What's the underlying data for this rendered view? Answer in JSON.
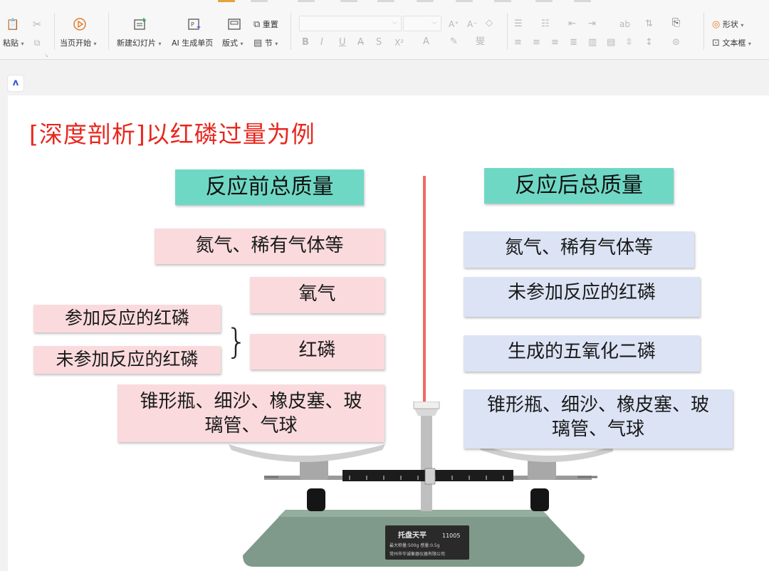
{
  "toolbar": {
    "paste_label": "粘贴",
    "start_from_current_label": "当页开始",
    "new_slide_label": "新建幻灯片",
    "ai_generate_label": "AI 生成单页",
    "layout_label": "版式",
    "reset_label": "重置",
    "section_label": "节",
    "shape_label": "形状",
    "textbox_label": "文本框"
  },
  "slide": {
    "title": "[深度剖析]以红磷过量为例",
    "left_header": "反应前总质量",
    "right_header": "反应后总质量",
    "left_items": {
      "nitrogen": "氮气、稀有气体等",
      "oxygen": "氧气",
      "phosphorus": "红磷",
      "reacted_phosphorus": "参加反应的红磷",
      "unreacted_phosphorus": "未参加反应的红磷",
      "apparatus_line1": "锥形瓶、细沙、橡皮塞、玻",
      "apparatus_line2": "璃管、气球"
    },
    "right_items": {
      "nitrogen": "氮气、稀有气体等",
      "unreacted_phosphorus": "未参加反应的红磷",
      "product": "生成的五氧化二磷",
      "apparatus_line1": "锥形瓶、细沙、橡皮塞、玻",
      "apparatus_line2": "璃管、气球"
    },
    "balance": {
      "plate_text": "托盘天平",
      "model": "11005",
      "spec": "最大称量:500g  感量:0.5g",
      "maker": "常州市华诚衡器仪器有限公司"
    }
  },
  "colors": {
    "title": "#e8271e",
    "header_bg": "#6fd8c5",
    "left_box_bg": "#fadadd",
    "right_box_bg": "#dbe3f4",
    "divider": "#f06a6a"
  }
}
